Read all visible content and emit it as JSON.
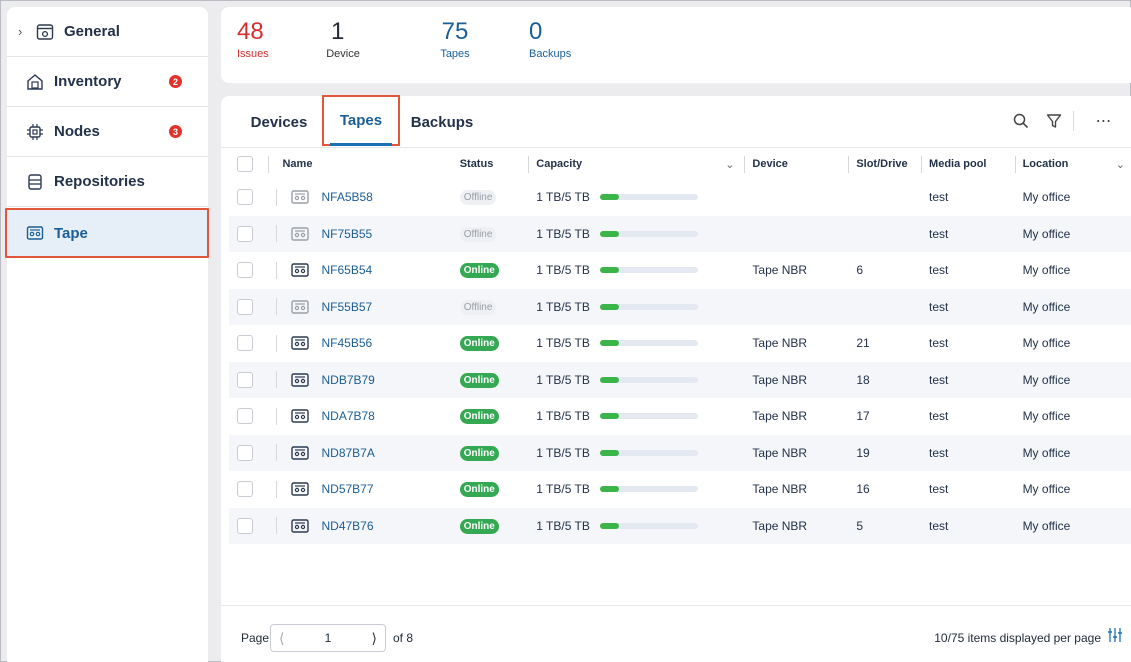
{
  "sidebar": {
    "items": [
      {
        "label": "General",
        "badge": ""
      },
      {
        "label": "Inventory",
        "badge": "2"
      },
      {
        "label": "Nodes",
        "badge": "3"
      },
      {
        "label": "Repositories",
        "badge": ""
      },
      {
        "label": "Tape",
        "badge": ""
      }
    ],
    "active": "Tape"
  },
  "summary": {
    "issues": {
      "value": "48",
      "label": "Issues"
    },
    "device": {
      "value": "1",
      "label": "Device"
    },
    "tapes": {
      "value": "75",
      "label": "Tapes"
    },
    "backups": {
      "value": "0",
      "label": "Backups"
    }
  },
  "tabs": [
    "Devices",
    "Tapes",
    "Backups"
  ],
  "active_tab": "Tapes",
  "table": {
    "columns": [
      "Name",
      "Status",
      "Capacity",
      "Device",
      "Slot/Drive",
      "Media pool",
      "Location"
    ],
    "rows": [
      {
        "name": "NFA5B58",
        "status": "Offline",
        "capacity": "1 TB/5 TB",
        "used_fraction": 0.2,
        "device": "",
        "slot": "",
        "pool": "test",
        "location": "My office"
      },
      {
        "name": "NF75B55",
        "status": "Offline",
        "capacity": "1 TB/5 TB",
        "used_fraction": 0.2,
        "device": "",
        "slot": "",
        "pool": "test",
        "location": "My office"
      },
      {
        "name": "NF65B54",
        "status": "Online",
        "capacity": "1 TB/5 TB",
        "used_fraction": 0.2,
        "device": "Tape NBR",
        "slot": "6",
        "pool": "test",
        "location": "My office"
      },
      {
        "name": "NF55B57",
        "status": "Offline",
        "capacity": "1 TB/5 TB",
        "used_fraction": 0.2,
        "device": "",
        "slot": "",
        "pool": "test",
        "location": "My office"
      },
      {
        "name": "NF45B56",
        "status": "Online",
        "capacity": "1 TB/5 TB",
        "used_fraction": 0.2,
        "device": "Tape NBR",
        "slot": "21",
        "pool": "test",
        "location": "My office"
      },
      {
        "name": "NDB7B79",
        "status": "Online",
        "capacity": "1 TB/5 TB",
        "used_fraction": 0.2,
        "device": "Tape NBR",
        "slot": "18",
        "pool": "test",
        "location": "My office"
      },
      {
        "name": "NDA7B78",
        "status": "Online",
        "capacity": "1 TB/5 TB",
        "used_fraction": 0.2,
        "device": "Tape NBR",
        "slot": "17",
        "pool": "test",
        "location": "My office"
      },
      {
        "name": "ND87B7A",
        "status": "Online",
        "capacity": "1 TB/5 TB",
        "used_fraction": 0.2,
        "device": "Tape NBR",
        "slot": "19",
        "pool": "test",
        "location": "My office"
      },
      {
        "name": "ND57B77",
        "status": "Online",
        "capacity": "1 TB/5 TB",
        "used_fraction": 0.2,
        "device": "Tape NBR",
        "slot": "16",
        "pool": "test",
        "location": "My office"
      },
      {
        "name": "ND47B76",
        "status": "Online",
        "capacity": "1 TB/5 TB",
        "used_fraction": 0.2,
        "device": "Tape NBR",
        "slot": "5",
        "pool": "test",
        "location": "My office"
      }
    ]
  },
  "pagination": {
    "page_label": "Page",
    "current_page": "1",
    "of_label": "of 8",
    "items_text": "10/75 items displayed per page"
  },
  "colors": {
    "accent": "#1b5e96",
    "issues": "#d32f2f",
    "online": "#34a853",
    "highlight_border": "#e2563c"
  }
}
